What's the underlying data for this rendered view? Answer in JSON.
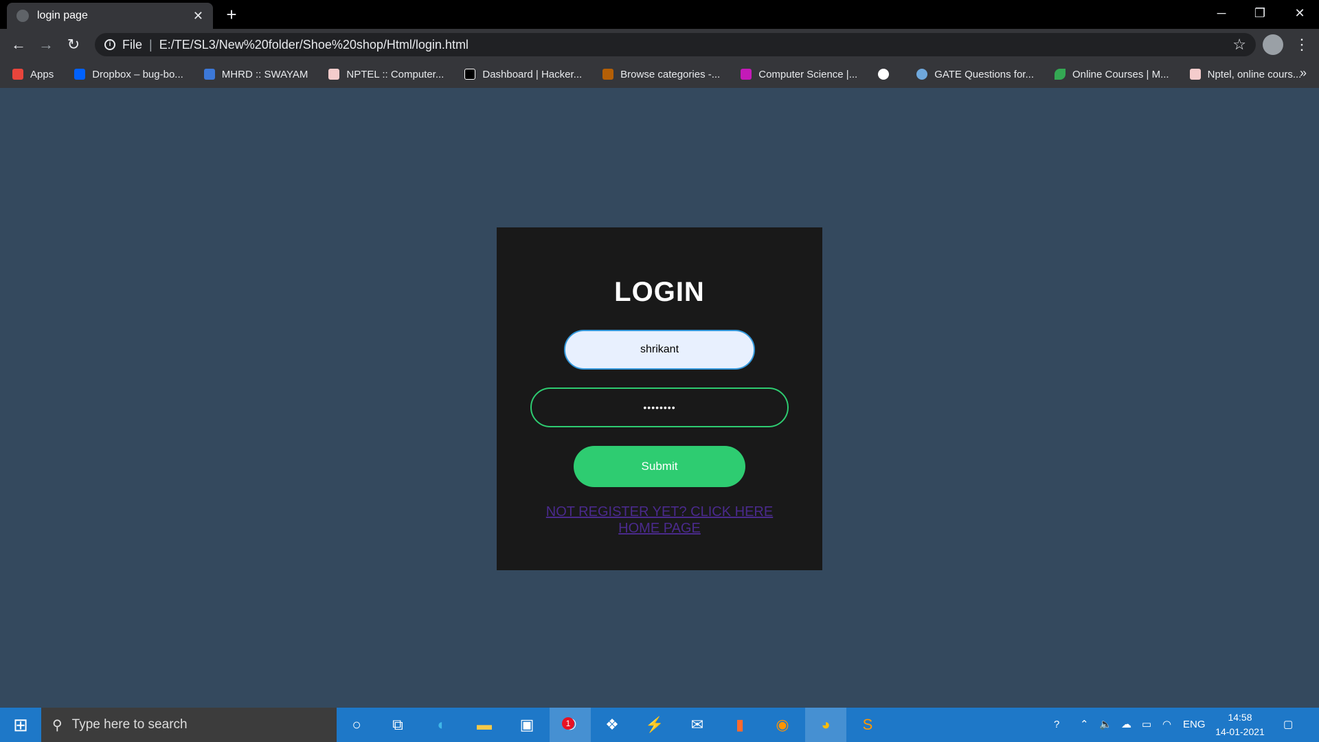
{
  "browser": {
    "tab_title": "login page",
    "new_tab": "+",
    "address": {
      "scheme_label": "File",
      "url": "E:/TE/SL3/New%20folder/Shoe%20shop/Html/login.html"
    },
    "bookmarks": [
      {
        "label": "Apps",
        "icon": "apps-grid-icon",
        "color": "#e8453c"
      },
      {
        "label": "Dropbox – bug-bo...",
        "icon": "dropbox-icon",
        "color": "#0061fe"
      },
      {
        "label": "MHRD :: SWAYAM",
        "icon": "swayam-icon",
        "color": "#3c78d8"
      },
      {
        "label": "NPTEL :: Computer...",
        "icon": "nptel-icon",
        "color": "#f4cccc"
      },
      {
        "label": "Dashboard | Hacker...",
        "icon": "hackerrank-icon",
        "color": "#000000"
      },
      {
        "label": "Browse categories -...",
        "icon": "browse-icon",
        "color": "#b45f06"
      },
      {
        "label": "Computer Science |...",
        "icon": "geeks-icon",
        "color": "#c41ab8"
      },
      {
        "label": "",
        "icon": "globe-icon",
        "color": "#ffffff"
      },
      {
        "label": "GATE Questions for...",
        "icon": "gate-icon",
        "color": "#6fa8dc"
      },
      {
        "label": "Online Courses | M...",
        "icon": "leaf-icon",
        "color": "#34a853"
      },
      {
        "label": "Nptel, online cours...",
        "icon": "nptel-icon",
        "color": "#f4cccc"
      }
    ],
    "more_bookmarks": "»"
  },
  "page": {
    "title": "LOGIN",
    "username_value": "shrikant",
    "password_value": "••••••••",
    "submit_label": "Submit",
    "register_link": "NOT REGISTER YET? CLICK HERE",
    "home_link": "HOME PAGE",
    "colors": {
      "background": "#34495e",
      "card": "#191919",
      "accent_green": "#2ecc71",
      "accent_blue": "#3498db",
      "link": "#4a2a8c"
    }
  },
  "taskbar": {
    "search_placeholder": "Type here to search",
    "notification_badge": "1",
    "language": "ENG",
    "time": "14:58",
    "date": "14-01-2021"
  }
}
